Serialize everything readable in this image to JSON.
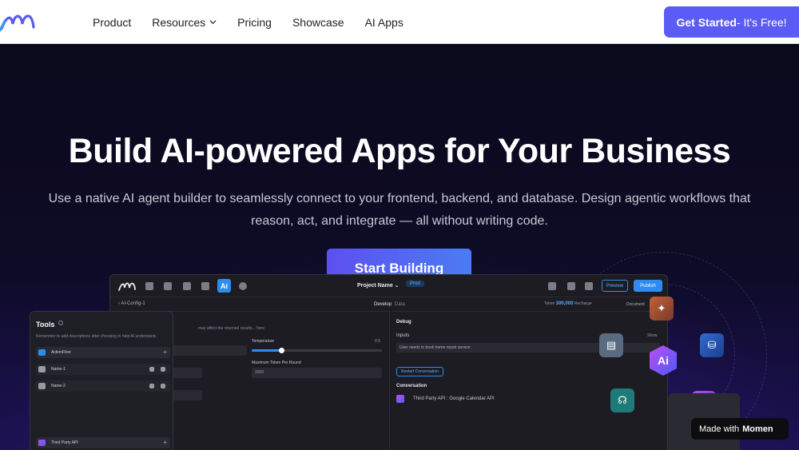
{
  "nav": {
    "links": [
      "Product",
      "Resources",
      "Pricing",
      "Showcase",
      "AI Apps"
    ],
    "cta_main": "Get Started",
    "cta_suffix": " - It's Free!"
  },
  "hero": {
    "title": "Build AI-powered Apps for Your Business",
    "subtitle": "Use a native AI agent builder to seamlessly connect to your frontend, backend, and database. Design agentic workflows that reason, act, and integrate — all without writing code.",
    "button": "Start Building"
  },
  "app": {
    "project_name": "Project Name ⌄",
    "env_badge": "Prod",
    "preview_label": "Preview",
    "publish_label": "Publish",
    "breadcrumb": "‹  AI-Config-1",
    "tabs": [
      "Develop",
      "Data"
    ],
    "tokens_label": "Token",
    "tokens_value": "300,000",
    "tokens_action": "Recharge",
    "document_label": "Document",
    "warning": "may affect the returned results... here",
    "temperature_label": "Temperature",
    "temperature_value": "0.5",
    "temperature_level": 0.23,
    "max_tokens_label": "Maximum Token Per Round",
    "max_tokens_value": "3000",
    "debug_label": "Debug",
    "inputs_label": "Inputs",
    "show_label": "Show",
    "input_value": "User needs to book home repair service",
    "restart_label": "Restart Conversation",
    "conversation_label": "Conversation",
    "third_party": "Third Party API : Google Calendar API"
  },
  "tools": {
    "title": "Tools",
    "note": "Remember to add descriptions after choosing to help AI understand.",
    "items": [
      {
        "label": "ActionFlow",
        "color": "#2e8cf0"
      },
      {
        "label": "Name-1",
        "color": "#9a9aa5"
      },
      {
        "label": "Name-2",
        "color": "#9a9aa5"
      },
      {
        "label": "Third Party API",
        "color": "#b44df0"
      }
    ]
  },
  "badge": {
    "made_with": "Made with",
    "brand": "Momen"
  },
  "colors": {
    "accent": "#5b5bf5",
    "blue": "#2e8cf0",
    "hero_bg": "#0b0a1c"
  }
}
